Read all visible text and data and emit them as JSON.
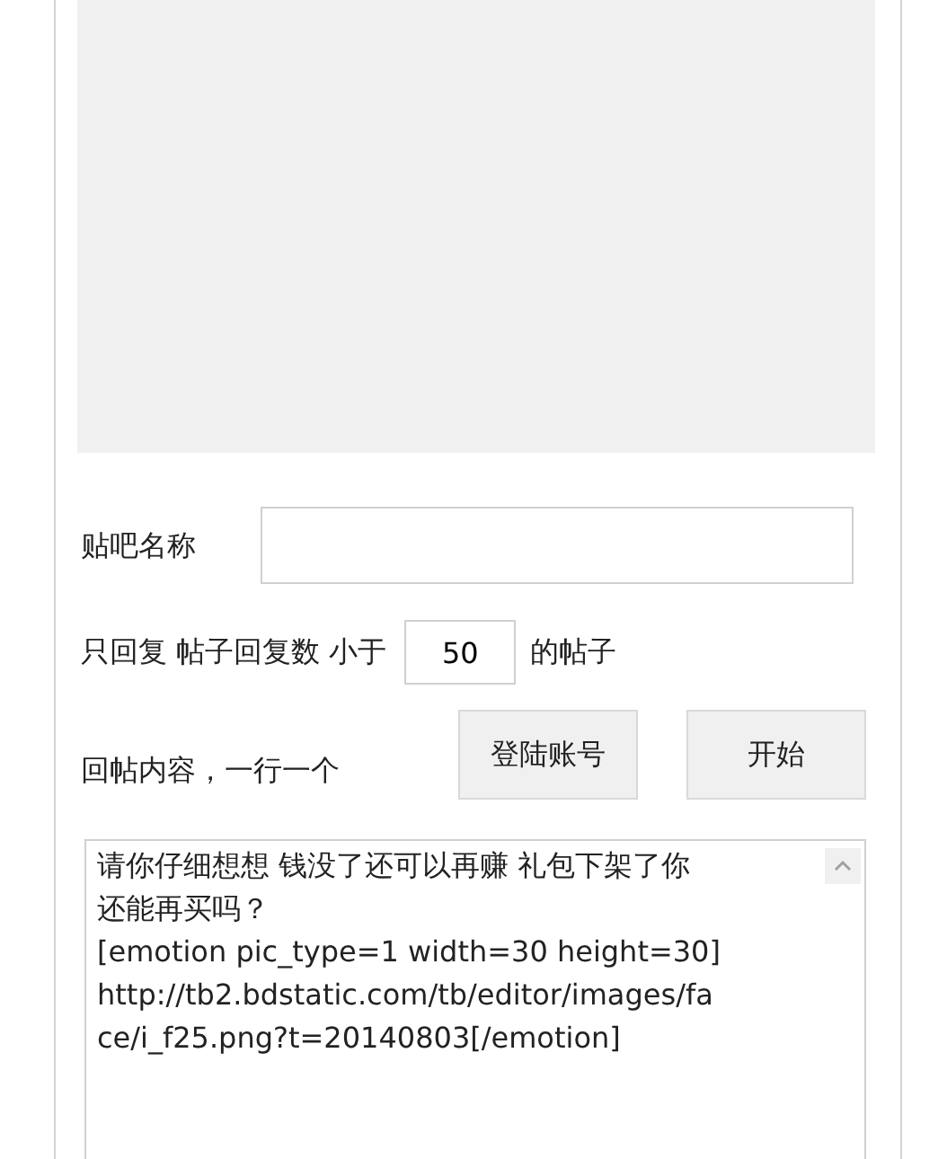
{
  "forum_name": {
    "label": "贴吧名称"
  },
  "reply_filter": {
    "prefix": "只回复 帖子回复数 小于",
    "value": "50",
    "suffix": "的帖子"
  },
  "reply_content": {
    "label": "回帖内容，一行一个",
    "lines": [
      "请你仔细想想 钱没了还可以再赚 礼包下架了你",
      "还能再买吗？",
      "[emotion pic_type=1 width=30 height=30]",
      "http://tb2.bdstatic.com/tb/editor/images/fa",
      "ce/i_f25.png?t=20140803[/emotion]"
    ]
  },
  "buttons": [
    "登陆账号",
    "开始"
  ]
}
